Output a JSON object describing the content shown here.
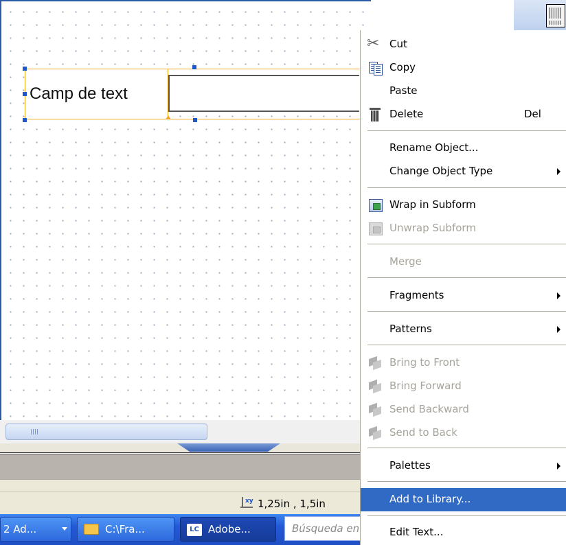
{
  "canvas": {
    "field_caption": "Camp de text"
  },
  "status": {
    "coordinates": "1,25in , 1,5in"
  },
  "taskbar": {
    "items": [
      {
        "label": "2 Ad...",
        "icon": "window-group-icon"
      },
      {
        "label": "C:\\Fra...",
        "icon": "folder-icon"
      },
      {
        "label": "Adobe...",
        "icon": "livecycle-icon",
        "active": true
      }
    ],
    "search_placeholder": "Búsqueda en",
    "lc_badge": "LC"
  },
  "context_menu": {
    "items": [
      {
        "label": "Cut",
        "icon": "scissors-icon",
        "enabled": true
      },
      {
        "label": "Copy",
        "icon": "copy-icon",
        "enabled": true
      },
      {
        "label": "Paste",
        "enabled": true
      },
      {
        "label": "Delete",
        "icon": "trash-icon",
        "shortcut": "Del",
        "enabled": true
      },
      {
        "label": "Rename Object...",
        "enabled": true
      },
      {
        "label": "Change Object Type",
        "submenu": true,
        "enabled": true
      },
      {
        "label": "Wrap in Subform",
        "icon": "wrap-subform-icon",
        "enabled": true
      },
      {
        "label": "Unwrap Subform",
        "icon": "unwrap-subform-icon",
        "enabled": false
      },
      {
        "label": "Merge",
        "enabled": false
      },
      {
        "label": "Fragments",
        "submenu": true,
        "enabled": true
      },
      {
        "label": "Patterns",
        "submenu": true,
        "enabled": true
      },
      {
        "label": "Bring to Front",
        "icon": "bring-to-front-icon",
        "enabled": false
      },
      {
        "label": "Bring Forward",
        "icon": "bring-forward-icon",
        "enabled": false
      },
      {
        "label": "Send Backward",
        "icon": "send-backward-icon",
        "enabled": false
      },
      {
        "label": "Send to Back",
        "icon": "send-to-back-icon",
        "enabled": false
      },
      {
        "label": "Palettes",
        "submenu": true,
        "enabled": true
      },
      {
        "label": "Add to Library...",
        "enabled": true,
        "highlighted": true
      },
      {
        "label": "Edit Text...",
        "enabled": true
      }
    ]
  },
  "colors": {
    "selection_orange": "#f5a623",
    "menu_highlight": "#316ac5",
    "handle_blue": "#1f56c8",
    "taskbar_blue": "#2358d6"
  }
}
